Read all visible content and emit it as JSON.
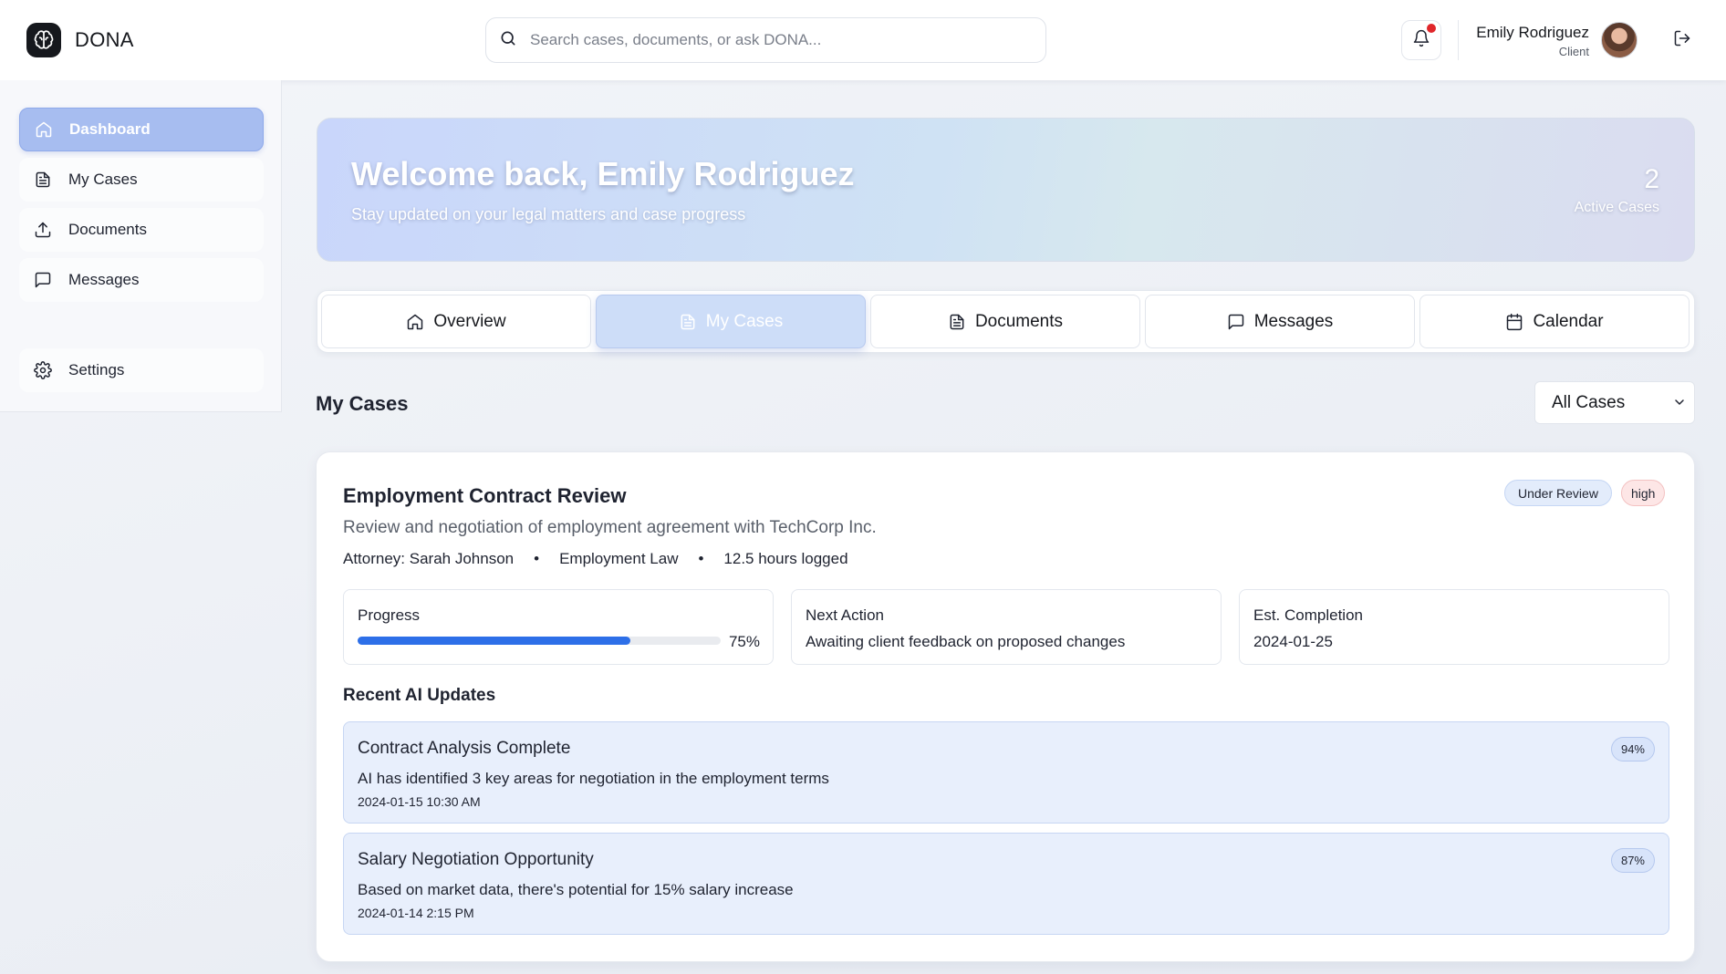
{
  "app": {
    "name": "DONA"
  },
  "search": {
    "placeholder": "Search cases, documents, or ask DONA..."
  },
  "user": {
    "name": "Emily Rodriguez",
    "role": "Client"
  },
  "sidebar": {
    "items": [
      {
        "label": "Dashboard",
        "icon": "home-icon"
      },
      {
        "label": "My Cases",
        "icon": "file-text-icon"
      },
      {
        "label": "Documents",
        "icon": "upload-icon"
      },
      {
        "label": "Messages",
        "icon": "message-square-icon"
      },
      {
        "label": "Settings",
        "icon": "gear-icon"
      }
    ],
    "active_index": 0
  },
  "hero": {
    "title": "Welcome back, Emily Rodriguez",
    "subtitle": "Stay updated on your legal matters and case progress",
    "active_count": "2",
    "active_label": "Active Cases"
  },
  "tabs": [
    {
      "label": "Overview",
      "icon": "home-icon"
    },
    {
      "label": "My Cases",
      "icon": "file-text-icon"
    },
    {
      "label": "Documents",
      "icon": "file-text-icon"
    },
    {
      "label": "Messages",
      "icon": "message-square-icon"
    },
    {
      "label": "Calendar",
      "icon": "calendar-icon"
    }
  ],
  "active_tab_index": 1,
  "section": {
    "title": "My Cases",
    "filter_value": "All Cases"
  },
  "case": {
    "title": "Employment Contract Review",
    "description": "Review and negotiation of employment agreement with TechCorp Inc.",
    "attorney": "Attorney: Sarah Johnson",
    "practice_area": "Employment Law",
    "hours": "12.5 hours logged",
    "separator": "•",
    "status": "Under Review",
    "priority": "high",
    "progress_label": "Progress",
    "progress_value": 75,
    "progress_text": "75%",
    "next_action_label": "Next Action",
    "next_action": "Awaiting client feedback on proposed changes",
    "completion_label": "Est. Completion",
    "completion_date": "2024-01-25",
    "updates_title": "Recent AI Updates",
    "updates": [
      {
        "title": "Contract Analysis Complete",
        "body": "AI has identified 3 key areas for negotiation in the employment terms",
        "time": "2024-01-15 10:30 AM",
        "confidence": "94%"
      },
      {
        "title": "Salary Negotiation Opportunity",
        "body": "Based on market data, there's potential for 15% salary increase",
        "time": "2024-01-14 2:15 PM",
        "confidence": "87%"
      }
    ]
  },
  "colors": {
    "accent": "#2d6fe8",
    "active_nav": "#a7bdf0",
    "notification_dot": "#e0262a",
    "priority_high_bg": "#fde6e6",
    "status_bg": "#e3ecfb"
  }
}
